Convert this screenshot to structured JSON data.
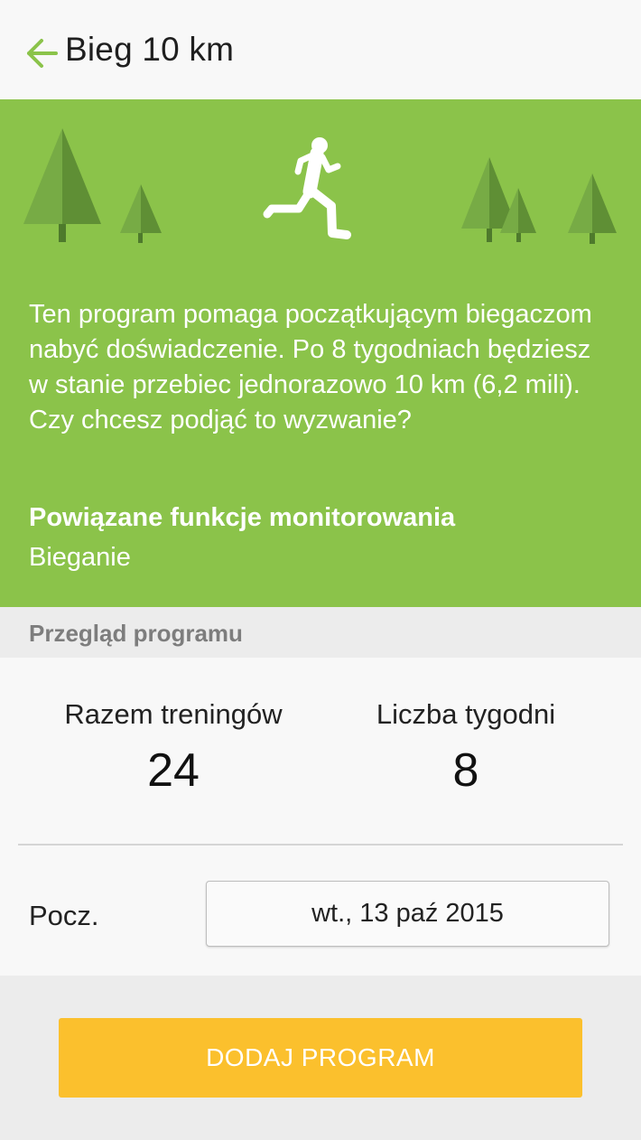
{
  "header": {
    "back_icon": "arrow-left-icon",
    "title": "Bieg 10 km",
    "accent_color": "#8bc34a"
  },
  "hero": {
    "background_color": "#8bc34a",
    "illustration": [
      "tree-icon",
      "running-person-icon"
    ],
    "description": "Ten program pomaga początkującym biegaczom nabyć doświadczenie. Po 8 tygodniach będziesz w stanie przebiec jednorazowo 10 km (6,2 mili). Czy chcesz podjąć to wyzwanie?",
    "related_title": "Powiązane funkcje monitorowania",
    "related_item": "Bieganie"
  },
  "overview": {
    "header": "Przegląd programu",
    "total_workouts_label": "Razem treningów",
    "total_workouts_value": "24",
    "weeks_label": "Liczba tygodni",
    "weeks_value": "8",
    "start_label": "Pocz.",
    "start_date": "wt., 13 paź 2015"
  },
  "actions": {
    "add_program_label": "DODAJ PROGRAM",
    "button_color": "#fbc02d"
  }
}
